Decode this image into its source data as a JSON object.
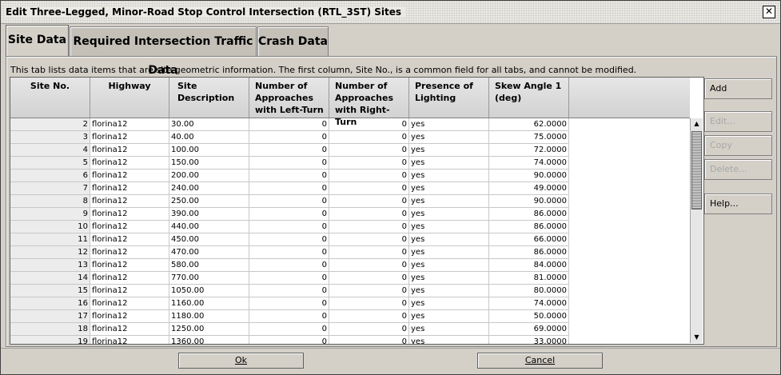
{
  "window": {
    "title": "Edit Three-Legged, Minor-Road Stop Control Intersection (RTL_3ST) Sites",
    "close_glyph": "✕"
  },
  "tabs": [
    {
      "label": "Site Data",
      "active": true
    },
    {
      "label": "Required Intersection Traffic Data",
      "active": false
    },
    {
      "label": "Crash Data",
      "active": false
    }
  ],
  "info_text": "This tab lists data items that are site geometric information. The first column, Site No., is a common field for all tabs, and cannot be modified.",
  "table": {
    "headers": [
      "Site No.",
      "Highway",
      "Site Description",
      "Number of Approaches with Left-Turn",
      "Number of Approaches with Right-Turn",
      "Presence of Lighting",
      "Skew Angle 1 (deg)"
    ],
    "rows": [
      [
        "2",
        "florina12",
        "30.00",
        "0",
        "0",
        "yes",
        "62.0000"
      ],
      [
        "3",
        "florina12",
        "40.00",
        "0",
        "0",
        "yes",
        "75.0000"
      ],
      [
        "4",
        "florina12",
        "100.00",
        "0",
        "0",
        "yes",
        "72.0000"
      ],
      [
        "5",
        "florina12",
        "150.00",
        "0",
        "0",
        "yes",
        "74.0000"
      ],
      [
        "6",
        "florina12",
        "200.00",
        "0",
        "0",
        "yes",
        "90.0000"
      ],
      [
        "7",
        "florina12",
        "240.00",
        "0",
        "0",
        "yes",
        "49.0000"
      ],
      [
        "8",
        "florina12",
        "250.00",
        "0",
        "0",
        "yes",
        "90.0000"
      ],
      [
        "9",
        "florina12",
        "390.00",
        "0",
        "0",
        "yes",
        "86.0000"
      ],
      [
        "10",
        "florina12",
        "440.00",
        "0",
        "0",
        "yes",
        "86.0000"
      ],
      [
        "11",
        "florina12",
        "450.00",
        "0",
        "0",
        "yes",
        "66.0000"
      ],
      [
        "12",
        "florina12",
        "470.00",
        "0",
        "0",
        "yes",
        "86.0000"
      ],
      [
        "13",
        "florina12",
        "580.00",
        "0",
        "0",
        "yes",
        "84.0000"
      ],
      [
        "14",
        "florina12",
        "770.00",
        "0",
        "0",
        "yes",
        "81.0000"
      ],
      [
        "15",
        "florina12",
        "1050.00",
        "0",
        "0",
        "yes",
        "80.0000"
      ],
      [
        "16",
        "florina12",
        "1160.00",
        "0",
        "0",
        "yes",
        "74.0000"
      ],
      [
        "17",
        "florina12",
        "1180.00",
        "0",
        "0",
        "yes",
        "50.0000"
      ],
      [
        "18",
        "florina12",
        "1250.00",
        "0",
        "0",
        "yes",
        "69.0000"
      ],
      [
        "19",
        "florina12",
        "1360.00",
        "0",
        "0",
        "yes",
        "33.0000"
      ]
    ]
  },
  "side_buttons": [
    {
      "label": "Add",
      "enabled": true
    },
    {
      "label": "Edit...",
      "enabled": false
    },
    {
      "label": "Copy",
      "enabled": false
    },
    {
      "label": "Delete...",
      "enabled": false
    },
    {
      "label": "Help...",
      "enabled": true
    }
  ],
  "footer": {
    "ok_label": "Ok",
    "cancel_label": "Cancel"
  },
  "scroll": {
    "up_glyph": "▲",
    "down_glyph": "▼"
  }
}
